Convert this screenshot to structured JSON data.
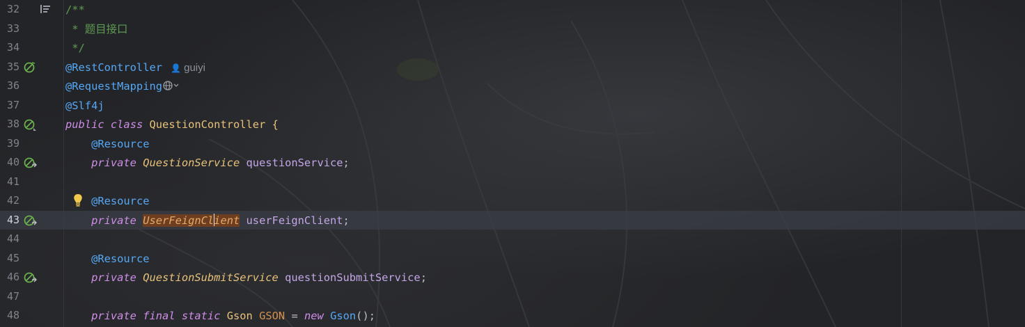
{
  "editor": {
    "colors": {
      "background": "#232427",
      "comment": "#5f9b52",
      "annotation": "#56a8f5",
      "keyword": "#cf8ee8",
      "type": "#e8c27a",
      "identifier": "#c4a6e8",
      "highlight": "#6d3e1f"
    },
    "current_line": 43,
    "lines": [
      {
        "num": "32",
        "gutter_icon": "fold-toggle-icon",
        "text": "/**"
      },
      {
        "num": "33",
        "gutter_icon": "",
        "text": " * 题目接口"
      },
      {
        "num": "34",
        "gutter_icon": "",
        "text": " */"
      },
      {
        "num": "35",
        "gutter_icon": "spring-bean-icon",
        "text": "@RestController",
        "author": "guiyi"
      },
      {
        "num": "36",
        "gutter_icon": "",
        "text": "@RequestMapping"
      },
      {
        "num": "37",
        "gutter_icon": "",
        "text": "@Slf4j"
      },
      {
        "num": "38",
        "gutter_icon": "spring-bean-icon",
        "text": "public class QuestionController {"
      },
      {
        "num": "39",
        "gutter_icon": "",
        "text": "    @Resource"
      },
      {
        "num": "40",
        "gutter_icon": "navigate-bean-icon",
        "text": "    private QuestionService questionService;"
      },
      {
        "num": "41",
        "gutter_icon": "",
        "text": ""
      },
      {
        "num": "42",
        "gutter_icon": "intention-bulb-icon",
        "text": "    @Resource"
      },
      {
        "num": "43",
        "gutter_icon": "navigate-bean-icon",
        "text": "    private UserFeignClient userFeignClient;"
      },
      {
        "num": "44",
        "gutter_icon": "",
        "text": ""
      },
      {
        "num": "45",
        "gutter_icon": "",
        "text": "    @Resource"
      },
      {
        "num": "46",
        "gutter_icon": "navigate-bean-icon",
        "text": "    private QuestionSubmitService questionSubmitService;"
      },
      {
        "num": "47",
        "gutter_icon": "",
        "text": ""
      },
      {
        "num": "48",
        "gutter_icon": "",
        "text": "    private final static Gson GSON = new Gson();"
      }
    ],
    "tokens": {
      "l32": "/**",
      "l33": " * 题目接口",
      "l34": " */",
      "l35_anno": "@RestController",
      "l35_author": "guiyi",
      "l36_anno": "@RequestMapping",
      "l37_anno": "@Slf4j",
      "l38_kw1": "public",
      "l38_kw2": "class",
      "l38_cls": "QuestionController",
      "l38_brace": " {",
      "l39_anno": "@Resource",
      "l40_kw": "private",
      "l40_type": "QuestionService",
      "l40_field": "questionService",
      "semi": ";",
      "l42_anno": "@Resource",
      "l43_kw": "private",
      "l43_type_a": "UserFeignCl",
      "l43_type_b": "ient",
      "l43_field": "userFeignClient",
      "l45_anno": "@Resource",
      "l46_kw": "private",
      "l46_type": "QuestionSubmitService",
      "l46_field": "questionSubmitService",
      "l48_kw1": "private",
      "l48_kw2": "final",
      "l48_kw3": "static",
      "l48_type": "Gson",
      "l48_const": "GSON",
      "l48_eq": " = ",
      "l48_new": "new",
      "l48_newcls": "Gson",
      "l48_tail": "();"
    }
  }
}
